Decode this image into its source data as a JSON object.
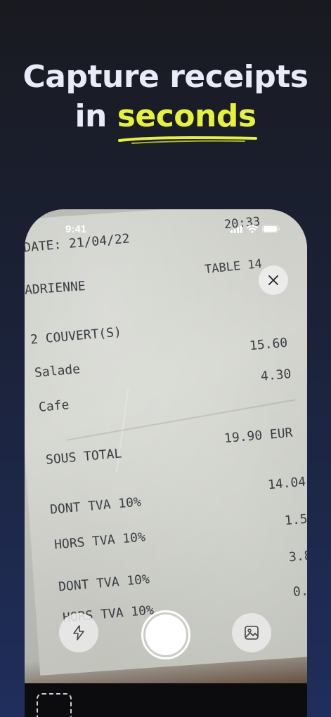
{
  "headline": {
    "line1": "Capture receipts",
    "line2_prefix": "in ",
    "line2_highlight": "seconds",
    "highlight_color": "#e6f23a"
  },
  "status_bar": {
    "time": "9:41",
    "icons": [
      "signal-icon",
      "wifi-icon",
      "battery-icon"
    ]
  },
  "receipt": {
    "clock": "20:33",
    "date": "DATE: 21/04/22",
    "table": "TABLE 14",
    "server": "ADRIENNE",
    "covers": "2 COUVERT(S)",
    "items": [
      {
        "name": "Salade",
        "price": "15.60"
      },
      {
        "name": "Cafe",
        "price": "4.30"
      }
    ],
    "subtotal_label": "SOUS TOTAL",
    "subtotal_value": "19.90 EUR",
    "tax_lines": [
      {
        "label": "DONT TVA 10%",
        "value": "14.04"
      },
      {
        "label": "HORS TVA 10%",
        "value": "1.5"
      },
      {
        "label": "DONT TVA 10%",
        "value": "3.8"
      },
      {
        "label": "HORS TVA 10%",
        "value": "0."
      }
    ]
  },
  "camera": {
    "close_icon": "close-icon",
    "flash_icon": "flash-icon",
    "gallery_icon": "image-icon"
  }
}
